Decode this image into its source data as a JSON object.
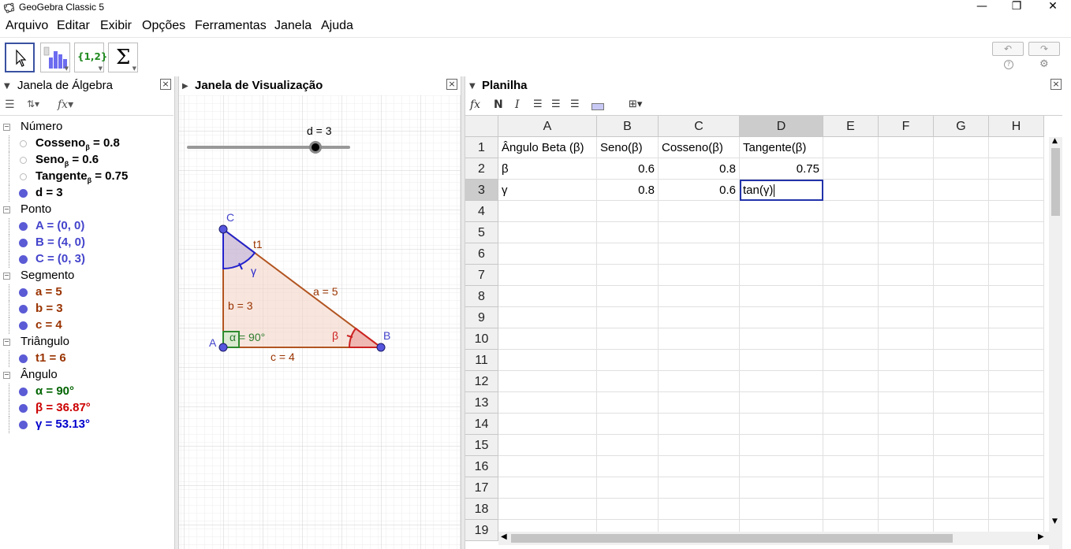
{
  "window": {
    "title": "GeoGebra Classic 5",
    "minimize": "—",
    "maximize": "❐",
    "close": "✕"
  },
  "menu": [
    "Arquivo",
    "Editar",
    "Exibir",
    "Opções",
    "Ferramentas",
    "Janela",
    "Ajuda"
  ],
  "toolbar": {
    "tools": [
      "move-tool",
      "histogram-tool",
      "list-tool",
      "sum-tool"
    ],
    "list_label": "{1,2}",
    "sum_label": "Σ",
    "undo": "↶",
    "redo": "↷",
    "help": "?",
    "settings": "⚙"
  },
  "algebra": {
    "title": "Janela de Álgebra",
    "categories": [
      {
        "name": "Número",
        "items": [
          {
            "label": "Cosseno",
            "sub": "β",
            "value": " = 0.8",
            "color": "#000000",
            "filled": false
          },
          {
            "label": "Seno",
            "sub": "β",
            "value": " = 0.6",
            "color": "#000000",
            "filled": false
          },
          {
            "label": "Tangente",
            "sub": "β",
            "value": " = 0.75",
            "color": "#000000",
            "filled": false
          },
          {
            "label": "d = 3",
            "sub": "",
            "value": "",
            "color": "#000000",
            "filled": true,
            "dot": "#5b5bd6"
          }
        ]
      },
      {
        "name": "Ponto",
        "items": [
          {
            "label": "A = (0, 0)",
            "color": "#4444cc",
            "filled": true,
            "dot": "#5b5bd6"
          },
          {
            "label": "B = (4, 0)",
            "color": "#4444cc",
            "filled": true,
            "dot": "#5b5bd6"
          },
          {
            "label": "C = (0, 3)",
            "color": "#4444cc",
            "filled": true,
            "dot": "#5b5bd6"
          }
        ]
      },
      {
        "name": "Segmento",
        "items": [
          {
            "label": "a = 5",
            "color": "#993300",
            "filled": true,
            "dot": "#5b5bd6"
          },
          {
            "label": "b = 3",
            "color": "#993300",
            "filled": true,
            "dot": "#5b5bd6"
          },
          {
            "label": "c = 4",
            "color": "#993300",
            "filled": true,
            "dot": "#5b5bd6"
          }
        ]
      },
      {
        "name": "Triângulo",
        "items": [
          {
            "label": "t1 = 6",
            "color": "#993300",
            "filled": true,
            "dot": "#5b5bd6"
          }
        ]
      },
      {
        "name": "Ângulo",
        "items": [
          {
            "label": "α = 90°",
            "color": "#006400",
            "filled": true,
            "dot": "#5b5bd6"
          },
          {
            "label": "β = 36.87°",
            "color": "#cc0000",
            "filled": true,
            "dot": "#5b5bd6"
          },
          {
            "label": "γ = 53.13°",
            "color": "#0000cc",
            "filled": true,
            "dot": "#5b5bd6"
          }
        ]
      }
    ]
  },
  "graphics": {
    "title": "Janela de Visualização",
    "slider_label": "d = 3",
    "points": {
      "A": "A",
      "B": "B",
      "C": "C"
    },
    "labels": {
      "t1": "t1",
      "a": "a = 5",
      "b": "b = 3",
      "c": "c = 4",
      "alpha": "α = 90°",
      "beta": "β",
      "gamma": "γ"
    }
  },
  "spreadsheet": {
    "title": "Planilha",
    "toolbar": {
      "fx": "fx",
      "bold": "N",
      "italic": "I"
    },
    "columns": [
      "A",
      "B",
      "C",
      "D",
      "E",
      "F",
      "G",
      "H"
    ],
    "selected_column": "D",
    "selected_row": "3",
    "rows": [
      "1",
      "2",
      "3",
      "4",
      "5",
      "6",
      "7",
      "8",
      "9",
      "10",
      "11",
      "12",
      "13",
      "14",
      "15",
      "16",
      "17",
      "18",
      "19"
    ],
    "cells": {
      "A1": "Ângulo Beta (β)",
      "B1": "Seno(β)",
      "C1": "Cosseno(β)",
      "D1": "Tangente(β)",
      "A2": "β",
      "B2": "0.6",
      "C2": "0.8",
      "D2": "0.75",
      "A3": "γ",
      "B3": "0.8",
      "C3": "0.6",
      "D3": "tan(γ)"
    }
  }
}
